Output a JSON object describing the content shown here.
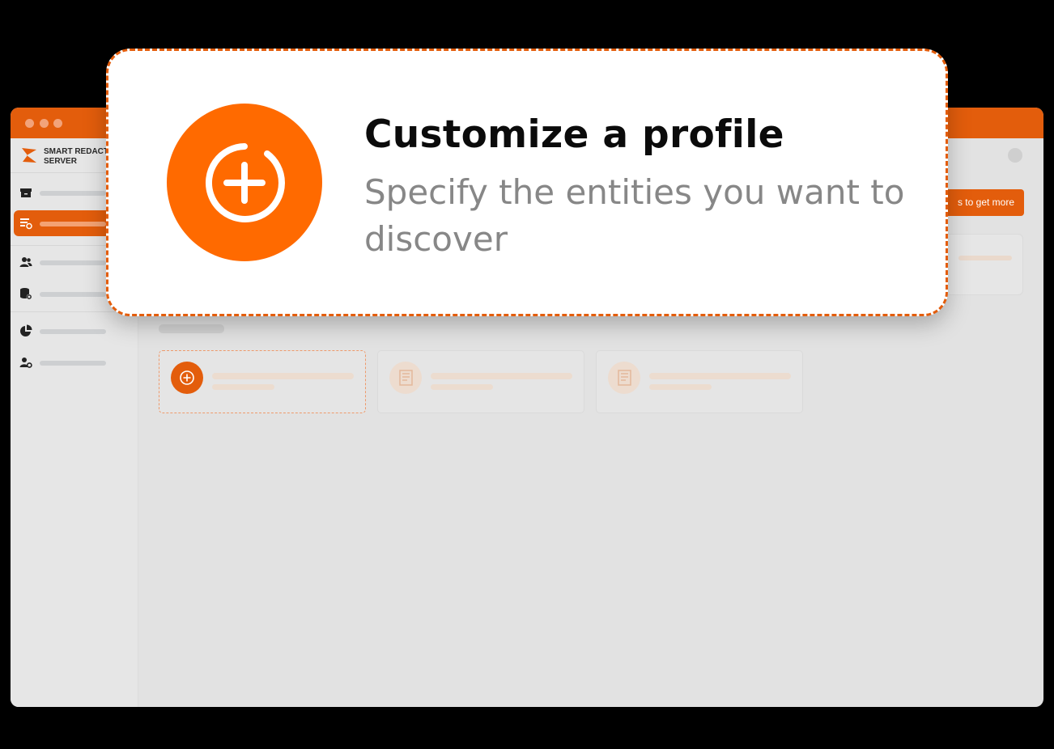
{
  "app": {
    "brand_line1": "SMART REDACT",
    "brand_line2": "SERVER",
    "get_more_button": "s to get more",
    "accent_color": "#e35d0c"
  },
  "sidebar": {
    "items": [
      {
        "icon": "archive-icon"
      },
      {
        "icon": "profile-list-icon",
        "active": true
      },
      {
        "icon": "users-icon"
      },
      {
        "icon": "database-settings-icon"
      },
      {
        "icon": "pie-chart-icon"
      },
      {
        "icon": "user-settings-icon"
      }
    ]
  },
  "profiles": [
    {
      "icon": "add-circle-icon",
      "selected": true
    },
    {
      "icon": "document-icon"
    },
    {
      "icon": "document-icon"
    }
  ],
  "callout": {
    "icon": "add-circle-icon",
    "title": "Customize a profile",
    "description": "Specify the entities you want to discover",
    "icon_color": "#ff6a00"
  }
}
